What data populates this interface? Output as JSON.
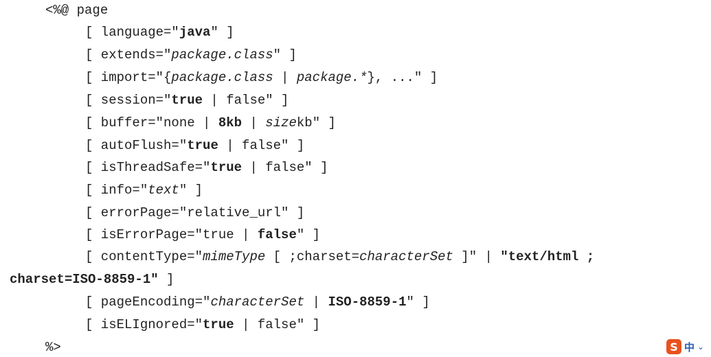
{
  "lines": [
    [
      {
        "t": "<%@ page"
      }
    ],
    [
      {
        "t": "[ language=\""
      },
      {
        "t": "java",
        "b": true
      },
      {
        "t": "\" ]"
      }
    ],
    [
      {
        "t": "[ extends=\""
      },
      {
        "t": "package.class",
        "i": true
      },
      {
        "t": "\" ]"
      }
    ],
    [
      {
        "t": "[ import=\"{"
      },
      {
        "t": "package.class",
        "i": true
      },
      {
        "t": " | "
      },
      {
        "t": "package.*",
        "i": true
      },
      {
        "t": "}, ...\" ]"
      }
    ],
    [
      {
        "t": "[ session=\""
      },
      {
        "t": "true",
        "b": true
      },
      {
        "t": " | false\" ]"
      }
    ],
    [
      {
        "t": "[ buffer=\"none | "
      },
      {
        "t": "8kb",
        "b": true
      },
      {
        "t": " | "
      },
      {
        "t": "size",
        "i": true
      },
      {
        "t": "kb\" ]"
      }
    ],
    [
      {
        "t": "[ autoFlush=\""
      },
      {
        "t": "true",
        "b": true
      },
      {
        "t": " | false\" ]"
      }
    ],
    [
      {
        "t": "[ isThreadSafe=\""
      },
      {
        "t": "true",
        "b": true
      },
      {
        "t": " | false\" ]"
      }
    ],
    [
      {
        "t": "[ info=\""
      },
      {
        "t": "text",
        "i": true
      },
      {
        "t": "\" ]"
      }
    ],
    [
      {
        "t": "[ errorPage=\"relative_url\" ]"
      }
    ],
    [
      {
        "t": "[ isErrorPage=\"true | "
      },
      {
        "t": "false",
        "b": true
      },
      {
        "t": "\" ]"
      }
    ],
    [
      {
        "t": "[ contentType=\""
      },
      {
        "t": "mimeType",
        "i": true
      },
      {
        "t": " [ ;charset="
      },
      {
        "t": "characterSet",
        "i": true
      },
      {
        "t": " ]\" | "
      },
      {
        "t": "\"text/html ;",
        "b": true
      }
    ],
    [
      {
        "t": "charset=ISO-8859-1\"",
        "b": true
      },
      {
        "t": " ]"
      }
    ],
    [
      {
        "t": "[ pageEncoding=\""
      },
      {
        "t": "characterSet",
        "i": true
      },
      {
        "t": " | "
      },
      {
        "t": "ISO-8859-1",
        "b": true
      },
      {
        "t": "\" ]"
      }
    ],
    [
      {
        "t": "[ isELIgnored=\""
      },
      {
        "t": "true",
        "b": true
      },
      {
        "t": " | false\" ]"
      }
    ],
    [
      {
        "t": "%>"
      }
    ]
  ],
  "ime": {
    "logo": "S",
    "label": "中",
    "arrow": "⌄"
  }
}
